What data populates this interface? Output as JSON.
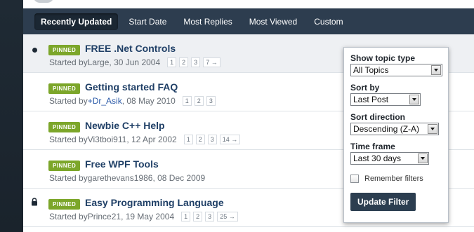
{
  "tabs": [
    {
      "label": "Recently Updated",
      "active": true
    },
    {
      "label": "Start Date"
    },
    {
      "label": "Most Replies"
    },
    {
      "label": "Most Viewed"
    },
    {
      "label": "Custom"
    }
  ],
  "topics": [
    {
      "badge": "PINNED",
      "title": "FREE .Net Controls",
      "started_prefix": "Started by ",
      "author": "Large",
      "date_suffix": ", 30 Jun 2004",
      "pages": [
        "1",
        "2",
        "3",
        "7 →"
      ],
      "marker": "unread-dot"
    },
    {
      "badge": "PINNED",
      "title": "Getting started FAQ",
      "started_prefix": "Started by ",
      "author": "+Dr_Asik",
      "date_suffix": ", 08 May 2010",
      "pages": [
        "1",
        "2",
        "3"
      ],
      "marker": "none"
    },
    {
      "badge": "PINNED",
      "title": "Newbie C++ Help",
      "started_prefix": "Started by ",
      "author": "Vi3tboi911",
      "date_suffix": ", 12 Apr 2002",
      "pages": [
        "1",
        "2",
        "3",
        "14 →"
      ],
      "marker": "none"
    },
    {
      "badge": "PINNED",
      "title": "Free WPF Tools",
      "started_prefix": "Started by ",
      "author": "garethevans1986",
      "date_suffix": ", 08 Dec 2009",
      "pages": [],
      "marker": "none"
    },
    {
      "badge": "PINNED",
      "title": "Easy Programming Language",
      "started_prefix": "Started by ",
      "author": "Prince21",
      "date_suffix": ", 19 May 2004",
      "pages": [
        "1",
        "2",
        "3",
        "25 →"
      ],
      "marker": "lock-icon"
    }
  ],
  "filter": {
    "topic_type_label": "Show topic type",
    "topic_type_value": "All Topics",
    "sort_by_label": "Sort by",
    "sort_by_value": "Last Post",
    "sort_direction_label": "Sort direction",
    "sort_direction_value": "Descending (Z-A)",
    "time_frame_label": "Time frame",
    "time_frame_value": "Last 30 days",
    "remember_label": "Remember filters",
    "remember_checked": false,
    "update_label": "Update Filter"
  },
  "colors": {
    "pinned_badge": "#7ca62a",
    "topic_title": "#1f3f66",
    "tab_bar": "#2d3d4f",
    "author_link": "#2b5aa8"
  }
}
